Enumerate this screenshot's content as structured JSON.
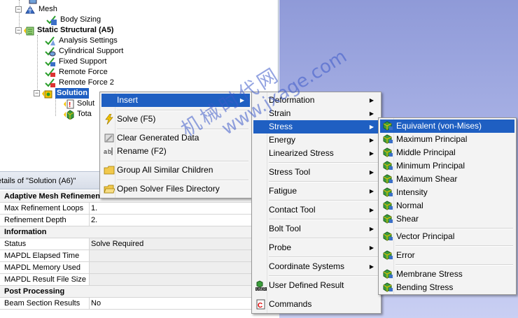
{
  "tree": {
    "items": [
      {
        "label": "Mesh",
        "bold": false
      },
      {
        "label": "Body Sizing",
        "bold": false
      },
      {
        "label": "Static Structural (A5)",
        "bold": true
      },
      {
        "label": "Analysis Settings",
        "bold": false
      },
      {
        "label": "Cylindrical Support",
        "bold": false
      },
      {
        "label": "Fixed Support",
        "bold": false
      },
      {
        "label": "Remote Force",
        "bold": false
      },
      {
        "label": "Remote Force 2",
        "bold": false
      },
      {
        "label": "Solution",
        "bold": true
      },
      {
        "label": "Solut",
        "bold": false
      },
      {
        "label": "Tota",
        "bold": false
      }
    ]
  },
  "details": {
    "title": "etails of \"Solution (A6)\"",
    "rows": [
      {
        "key": "Adaptive Mesh Refinement",
        "value": "",
        "section": true
      },
      {
        "key": "Max Refinement Loops",
        "value": "1.",
        "section": false
      },
      {
        "key": "Refinement Depth",
        "value": "2.",
        "section": false
      },
      {
        "key": "Information",
        "value": "",
        "section": true
      },
      {
        "key": "Status",
        "value": "Solve Required",
        "section": false
      },
      {
        "key": "MAPDL Elapsed Time",
        "value": "",
        "section": false
      },
      {
        "key": "MAPDL Memory Used",
        "value": "",
        "section": false
      },
      {
        "key": "MAPDL Result File Size",
        "value": "",
        "section": false
      },
      {
        "key": "Post Processing",
        "value": "",
        "section": true
      },
      {
        "key": "Beam Section Results",
        "value": "No",
        "section": false
      }
    ]
  },
  "context_menu": {
    "items": [
      {
        "label": "Insert",
        "submenu": true
      },
      {
        "label": "Solve (F5)",
        "submenu": false
      },
      {
        "label": "Clear Generated Data",
        "submenu": false
      },
      {
        "label": "Rename (F2)",
        "submenu": false
      },
      {
        "label": "Group All Similar Children",
        "submenu": false
      },
      {
        "label": "Open Solver Files Directory",
        "submenu": false
      }
    ]
  },
  "insert_menu": {
    "items": [
      {
        "label": "Deformation",
        "submenu": true
      },
      {
        "label": "Strain",
        "submenu": true
      },
      {
        "label": "Stress",
        "submenu": true
      },
      {
        "label": "Energy",
        "submenu": true
      },
      {
        "label": "Linearized Stress",
        "submenu": true
      },
      {
        "label": "Stress Tool",
        "submenu": true
      },
      {
        "label": "Fatigue",
        "submenu": true
      },
      {
        "label": "Contact Tool",
        "submenu": true
      },
      {
        "label": "Bolt Tool",
        "submenu": true
      },
      {
        "label": "Probe",
        "submenu": true
      },
      {
        "label": "Coordinate Systems",
        "submenu": true
      },
      {
        "label": "User Defined Result",
        "submenu": false
      },
      {
        "label": "Commands",
        "submenu": false
      }
    ]
  },
  "stress_menu": {
    "items": [
      {
        "label": "Equivalent (von-Mises)"
      },
      {
        "label": "Maximum Principal"
      },
      {
        "label": "Middle Principal"
      },
      {
        "label": "Minimum Principal"
      },
      {
        "label": "Maximum Shear"
      },
      {
        "label": "Intensity"
      },
      {
        "label": "Normal"
      },
      {
        "label": "Shear"
      },
      {
        "label": "Vector Principal"
      },
      {
        "label": "Error"
      },
      {
        "label": "Membrane Stress"
      },
      {
        "label": "Bending Stress"
      }
    ]
  },
  "watermark": {
    "line1": "机械时代网",
    "line2": "www.jxage.com"
  },
  "colors": {
    "selection": "#1f5fc2",
    "viewport_top": "#8f9ad8",
    "check_green": "#2a9d2a",
    "lightning_yellow": "#f2c200"
  }
}
